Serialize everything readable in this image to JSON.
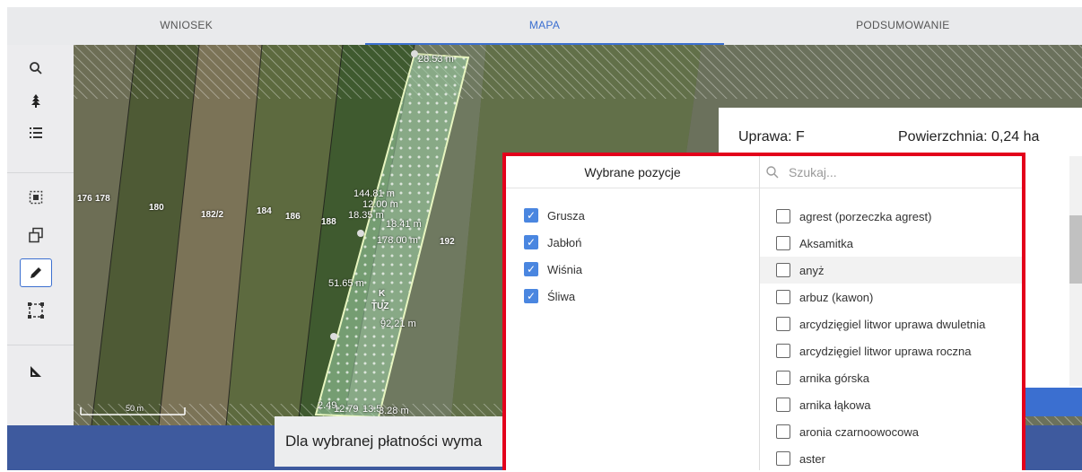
{
  "tabs": [
    {
      "label": "WNIOSEK",
      "active": false
    },
    {
      "label": "MAPA",
      "active": true
    },
    {
      "label": "PODSUMOWANIE",
      "active": false
    }
  ],
  "toolbar": {
    "icons": [
      "search-icon",
      "tree-icon",
      "list-icon",
      "select-area-icon",
      "copy-geometry-icon",
      "pencil-icon",
      "dashed-rect-icon",
      "measure-angle-icon"
    ],
    "active": "pencil-icon"
  },
  "map": {
    "parcel_numbers": [
      "176",
      "178",
      "180",
      "182/2",
      "184",
      "186",
      "188",
      "192"
    ],
    "measurements": [
      "28.53 m",
      "144.81 m",
      "12.00 m",
      "18.35 m",
      "18.41 m",
      "178.00 m",
      "51.65 m",
      "92.21 m",
      "2.49",
      "12.79",
      "13.5",
      "3.28 m"
    ],
    "parcel_marks": [
      "K",
      "TUZ"
    ],
    "scale": "50 m"
  },
  "banner": {
    "message": "Dla wybranej płatności wyma"
  },
  "panel": {
    "crop_label": "Uprawa: F",
    "area_label": "Powierzchnia: 0,24 ha"
  },
  "dropdown": {
    "selected_title": "Wybrane pozycje",
    "selected": [
      "Grusza",
      "Jabłoń",
      "Wiśnia",
      "Śliwa"
    ],
    "search_placeholder": "Szukaj...",
    "options": [
      "agrest (porzeczka agrest)",
      "Aksamitka",
      "anyż",
      "arbuz (kawon)",
      "arcydzięgiel litwor uprawa dwuletnia",
      "arcydzięgiel litwor uprawa roczna",
      "arnika górska",
      "arnika łąkowa",
      "aronia czarnoowocowa",
      "aster"
    ],
    "highlighted_index": 2
  },
  "colors": {
    "accent": "#3b6fd0",
    "highlight_border": "#e3001b",
    "banner": "#3e5a9e"
  }
}
